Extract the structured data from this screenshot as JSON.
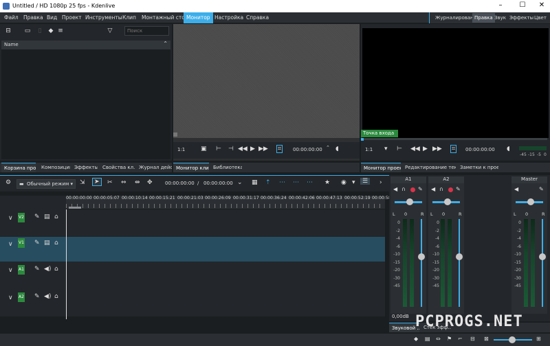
{
  "window": {
    "title": "Untitled / HD 1080p 25 fps - Kdenlive",
    "controls": [
      "–",
      "☐",
      "✕"
    ]
  },
  "menu": [
    "Файл",
    "Правка",
    "Вид",
    "Проект",
    "Инструменты",
    "Клип",
    "Монтажный стол",
    "Монитор",
    "Настройка",
    "Справка"
  ],
  "menu_active": "Монитор",
  "workspaces": [
    "Журналирование",
    "Правка",
    "Звук",
    "Эффекты",
    "Цвет"
  ],
  "workspace_active": "Правка",
  "bin": {
    "search_placeholder": "Поиск",
    "column": "Name"
  },
  "left_tabs": [
    "Корзина прое...",
    "Композиции",
    "Эффекты",
    "Свойства кл...",
    "Журнал дейс..."
  ],
  "clip_monitor": {
    "tabs": [
      "Монитор клипа",
      "Библиотека"
    ],
    "zoom": "1:1",
    "timecode": "00:00:00:00"
  },
  "project_monitor": {
    "tabs": [
      "Монитор проекта",
      "Редактирование текста",
      "Заметки к проекту"
    ],
    "zoom": "1:1",
    "timecode": "00:00:00:00",
    "marker": "Точка входа",
    "scale_labels": [
      "-45",
      "-15",
      "-5",
      "0"
    ]
  },
  "timeline": {
    "mode": "Обычный режим",
    "position": "00:00:00:00",
    "duration": "00:00:00:00",
    "ruler": [
      "00:00:00:00",
      "00:00:05:07",
      "00:00:10:14",
      "00:00:15:21",
      "00:00:21:03",
      "00:00:26:09",
      "00:00:31:17",
      "00:00:36:24",
      "00:00:42:06",
      "00:00:47:13",
      "00:00:52:19",
      "00:00:58"
    ],
    "tracks": [
      {
        "name": "V2",
        "type": "video"
      },
      {
        "name": "V1",
        "type": "video",
        "selected": true
      },
      {
        "name": "A1",
        "type": "audio"
      },
      {
        "name": "A2",
        "type": "audio"
      }
    ]
  },
  "mixer": {
    "channels": [
      {
        "name": "A1",
        "level": "0,00dB"
      },
      {
        "name": "A2"
      },
      {
        "name": "Master"
      }
    ],
    "scale": [
      "0",
      "-2",
      "-4",
      "-6",
      "-10",
      "-15",
      "-20",
      "-30",
      "-45"
    ],
    "lr": [
      "L",
      "0",
      "R"
    ],
    "tabs": [
      "Звуковой ...",
      "Стек эфф..."
    ]
  },
  "watermark": "PCPROGS.NET"
}
